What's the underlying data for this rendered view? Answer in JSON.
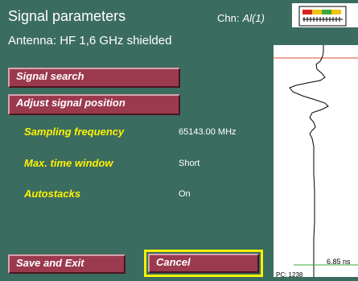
{
  "header": {
    "title": "Signal parameters",
    "chn_label": "Chn:",
    "chn_value": "Al(1)",
    "antenna": "Antenna: HF 1,6 GHz shielded"
  },
  "buttons": {
    "signal_search": "Signal search",
    "adjust_signal_position": "Adjust signal position",
    "save_and_exit": "Save and Exit",
    "cancel": "Cancel"
  },
  "params": [
    {
      "label": "Sampling frequency",
      "value": "65143.00 MHz"
    },
    {
      "label": "Max. time window",
      "value": "Short"
    },
    {
      "label": "Autostacks",
      "value": "On"
    }
  ],
  "trace": {
    "time_label": "6.85 ns",
    "bottom_label": "PC: 1238"
  },
  "colors": {
    "background": "#3b6c60",
    "button": "#9b3a4f",
    "label": "#fff200",
    "focus_frame": "#f7f200",
    "marker_line": "#e0483c",
    "scale_line": "#3aaa3a"
  }
}
